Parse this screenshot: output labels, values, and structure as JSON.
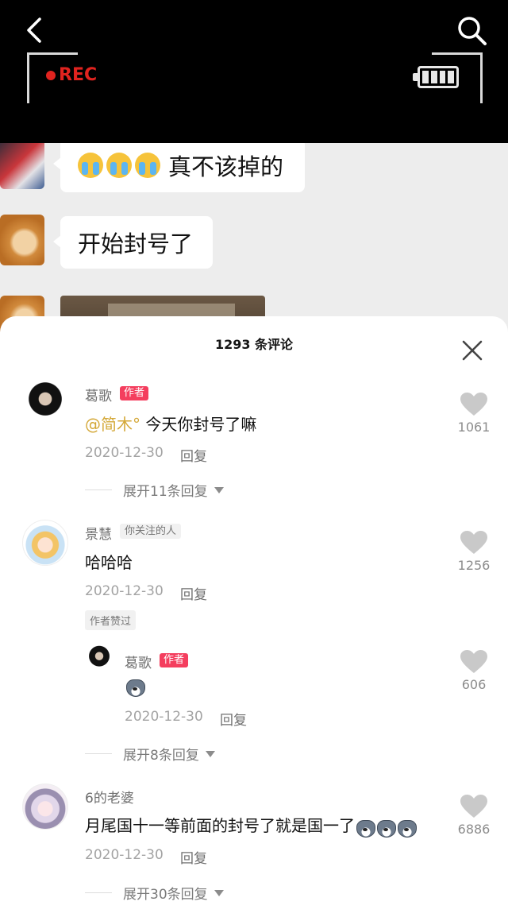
{
  "top": {
    "rec_label": "REC"
  },
  "chat": {
    "messages": [
      {
        "text": "真不该掉的",
        "emoji": "crying-face-icon x3"
      },
      {
        "text": "开始封号了"
      }
    ]
  },
  "sheet": {
    "title": "1293 条评论"
  },
  "comments": [
    {
      "name": "葛歌",
      "badge": "作者",
      "mention": "@简木°",
      "text": "今天你封号了嘛",
      "date": "2020-12-30",
      "reply": "回复",
      "likes": "1061",
      "expand": "展开11条回复"
    },
    {
      "name": "景慧",
      "badge": "你关注的人",
      "text": "哈哈哈",
      "date": "2020-12-30",
      "reply": "回复",
      "likes": "1256",
      "liked_badge": "作者赞过",
      "sub_reply": {
        "name": "葛歌",
        "badge": "作者",
        "emoji": "husky-icon",
        "date": "2020-12-30",
        "reply": "回复",
        "likes": "606"
      },
      "expand": "展开8条回复"
    },
    {
      "name": "6的老婆",
      "text": "月尾国十一等前面的封号了就是国一了",
      "emoji": "husky-icon x3",
      "date": "2020-12-30",
      "reply": "回复",
      "likes": "6886",
      "expand": "展开30条回复"
    }
  ],
  "colors": {
    "author_badge": "#f43e5e",
    "mention": "#d4a838",
    "rec": "#e0231f"
  }
}
